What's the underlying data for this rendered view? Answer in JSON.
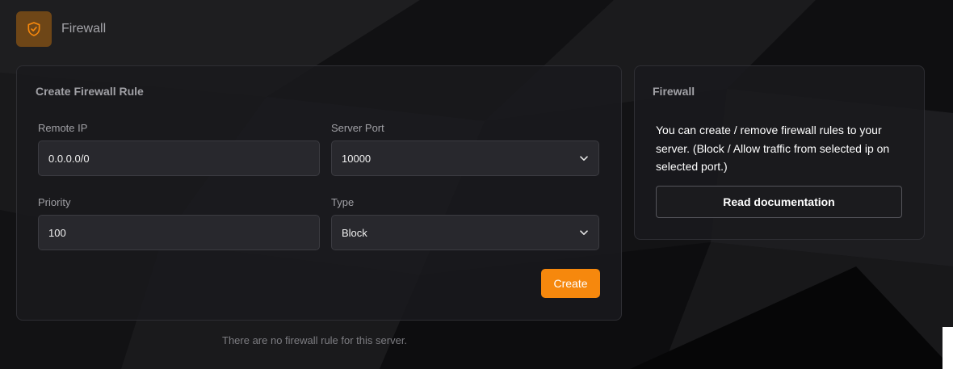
{
  "header": {
    "title": "Firewall",
    "icon": "shield-check-icon",
    "icon_color": "#f6880d"
  },
  "create_rule": {
    "title": "Create Firewall Rule",
    "remote_ip": {
      "label": "Remote IP",
      "value": "0.0.0.0/0"
    },
    "server_port": {
      "label": "Server Port",
      "selected": "10000"
    },
    "priority": {
      "label": "Priority",
      "value": "100"
    },
    "type": {
      "label": "Type",
      "selected": "Block"
    },
    "create_label": "Create"
  },
  "info": {
    "title": "Firewall",
    "text": "You can create / remove firewall rules to your server. (Block / Allow traffic from selected ip on selected port.)",
    "docs_label": "Read documentation"
  },
  "rules": {
    "empty_message": "There are no firewall rule for this server."
  },
  "colors": {
    "accent": "#f6880d",
    "background": "#141416",
    "card": "#1a1a1d"
  }
}
